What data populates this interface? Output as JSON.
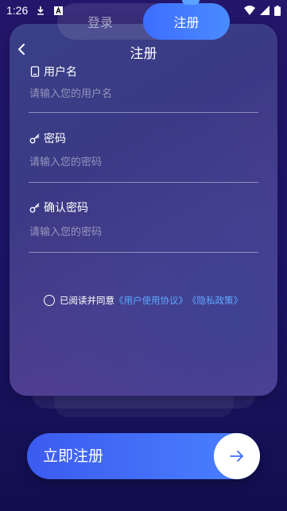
{
  "status_bar": {
    "time": "1:26",
    "icons": [
      "download-icon",
      "a-box-icon",
      "wifi-icon",
      "signal-icon",
      "battery-icon"
    ]
  },
  "tabs": {
    "login_label": "登录",
    "register_label": "注册",
    "active": "register"
  },
  "header": {
    "title": "注册",
    "back_icon": "chevron-left-icon"
  },
  "form": {
    "username": {
      "label": "用户名",
      "placeholder": "请输入您的用户名",
      "icon": "phone-icon"
    },
    "password": {
      "label": "密码",
      "placeholder": "请输入您的密码",
      "icon": "key-icon"
    },
    "confirm_password": {
      "label": "确认密码",
      "placeholder": "请输入您的密码",
      "icon": "key-icon"
    }
  },
  "agreement": {
    "prefix": "已阅读并同意",
    "user_agreement": "《用户使用协议》",
    "privacy_policy": "《隐私政策》"
  },
  "submit": {
    "label": "立即注册",
    "icon": "arrow-right-icon"
  },
  "colors": {
    "accent": "#3d6dff",
    "link": "#5fa8ff",
    "background": "#1b1466"
  }
}
